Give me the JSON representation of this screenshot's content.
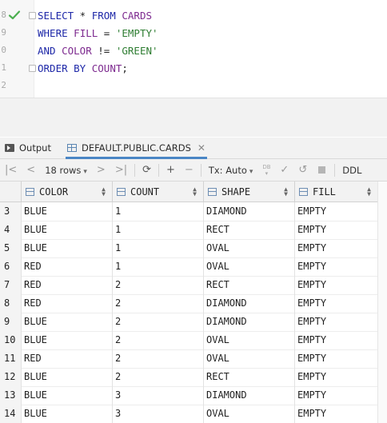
{
  "editor": {
    "line_numbers": [
      "8",
      "9",
      "0",
      "1",
      "2"
    ],
    "lines": [
      [
        {
          "t": "SELECT",
          "c": "kw"
        },
        {
          "t": " * ",
          "c": "op"
        },
        {
          "t": "FROM",
          "c": "kw"
        },
        {
          "t": " CARDS",
          "c": "id"
        }
      ],
      [
        {
          "t": "WHERE",
          "c": "kw"
        },
        {
          "t": " FILL",
          "c": "id"
        },
        {
          "t": " = ",
          "c": "op"
        },
        {
          "t": "'EMPTY'",
          "c": "str"
        }
      ],
      [
        {
          "t": "AND",
          "c": "kw"
        },
        {
          "t": " COLOR",
          "c": "id"
        },
        {
          "t": " != ",
          "c": "op"
        },
        {
          "t": "'GREEN'",
          "c": "str"
        }
      ],
      [
        {
          "t": "ORDER BY",
          "c": "kw"
        },
        {
          "t": " COUNT",
          "c": "id"
        },
        {
          "t": ";",
          "c": "op"
        }
      ]
    ]
  },
  "tabs": {
    "output_label": "Output",
    "result_label": "DEFAULT.PUBLIC.CARDS"
  },
  "toolbar": {
    "rows_label": "18 rows",
    "tx_label": "Tx: Auto",
    "ddl_label": "DDL"
  },
  "table": {
    "columns": [
      "COLOR",
      "COUNT",
      "SHAPE",
      "FILL"
    ],
    "rows": [
      {
        "n": "3",
        "cells": [
          "BLUE",
          "1",
          "DIAMOND",
          "EMPTY"
        ]
      },
      {
        "n": "4",
        "cells": [
          "BLUE",
          "1",
          "RECT",
          "EMPTY"
        ]
      },
      {
        "n": "5",
        "cells": [
          "BLUE",
          "1",
          "OVAL",
          "EMPTY"
        ]
      },
      {
        "n": "6",
        "cells": [
          "RED",
          "1",
          "OVAL",
          "EMPTY"
        ]
      },
      {
        "n": "7",
        "cells": [
          "RED",
          "2",
          "RECT",
          "EMPTY"
        ]
      },
      {
        "n": "8",
        "cells": [
          "RED",
          "2",
          "DIAMOND",
          "EMPTY"
        ]
      },
      {
        "n": "9",
        "cells": [
          "BLUE",
          "2",
          "DIAMOND",
          "EMPTY"
        ]
      },
      {
        "n": "10",
        "cells": [
          "BLUE",
          "2",
          "OVAL",
          "EMPTY"
        ]
      },
      {
        "n": "11",
        "cells": [
          "RED",
          "2",
          "OVAL",
          "EMPTY"
        ]
      },
      {
        "n": "12",
        "cells": [
          "BLUE",
          "2",
          "RECT",
          "EMPTY"
        ]
      },
      {
        "n": "13",
        "cells": [
          "BLUE",
          "3",
          "DIAMOND",
          "EMPTY"
        ]
      },
      {
        "n": "14",
        "cells": [
          "BLUE",
          "3",
          "OVAL",
          "EMPTY"
        ]
      }
    ]
  },
  "colors": {
    "keyword": "#1e28a8",
    "identifier": "#7d2a8f",
    "string": "#2e7d32",
    "check": "#4caf50",
    "tab_accent": "#4a86c5"
  }
}
